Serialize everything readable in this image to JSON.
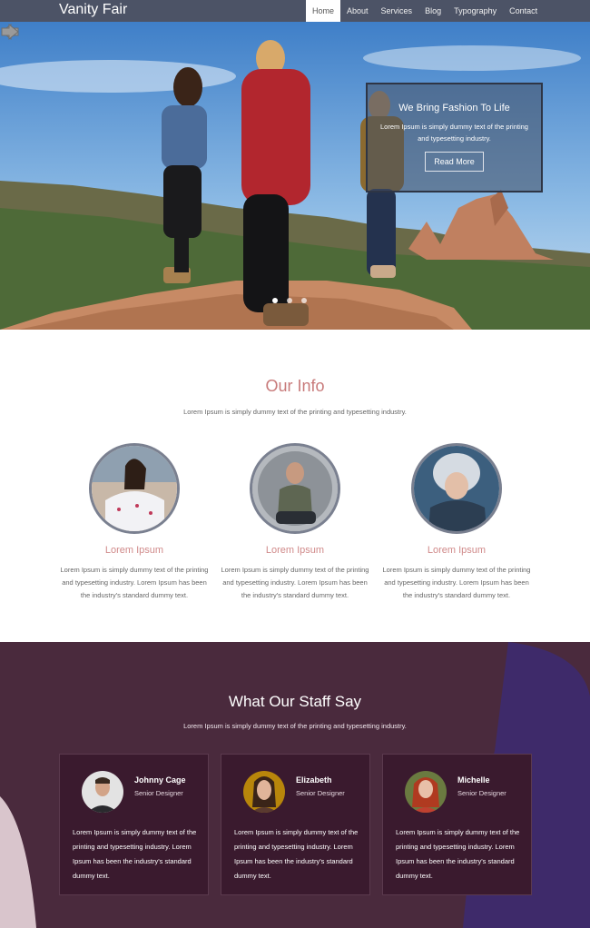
{
  "nav": {
    "brand": "Vanity Fair",
    "items": [
      {
        "label": "Home",
        "active": true
      },
      {
        "label": "About"
      },
      {
        "label": "Services"
      },
      {
        "label": "Blog"
      },
      {
        "label": "Typography"
      },
      {
        "label": "Contact"
      }
    ]
  },
  "hero": {
    "title": "We Bring Fashion To Life",
    "text": "Lorem Ipsum is simply dummy text of the printing and typesetting industry.",
    "button": "Read More"
  },
  "info": {
    "title": "Our Info",
    "subtitle": "Lorem Ipsum is simply dummy text of the printing and typesetting industry.",
    "cards": [
      {
        "name": "Lorem Ipsum",
        "text": "Lorem Ipsum is simply dummy text of the printing and typesetting industry. Lorem Ipsum has been the industry's standard dummy text."
      },
      {
        "name": "Lorem Ipsum",
        "text": "Lorem Ipsum is simply dummy text of the printing and typesetting industry. Lorem Ipsum has been the industry's standard dummy text."
      },
      {
        "name": "Lorem Ipsum",
        "text": "Lorem Ipsum is simply dummy text of the printing and typesetting industry. Lorem Ipsum has been the industry's standard dummy text."
      }
    ]
  },
  "staff": {
    "title": "What Our Staff Say",
    "subtitle": "Lorem Ipsum is simply dummy text of the printing and typesetting industry.",
    "members": [
      {
        "name": "Johnny Cage",
        "role": "Senior Designer",
        "text": "Lorem Ipsum is simply dummy text of the printing and typesetting industry. Lorem Ipsum has been the industry's standard dummy text."
      },
      {
        "name": "Elizabeth",
        "role": "Senior Designer",
        "text": "Lorem Ipsum is simply dummy text of the printing and typesetting industry. Lorem Ipsum has been the industry's standard dummy text."
      },
      {
        "name": "Michelle",
        "role": "Senior Designer",
        "text": "Lorem Ipsum is simply dummy text of the printing and typesetting industry. Lorem Ipsum has been the industry's standard dummy text."
      }
    ]
  },
  "colors": {
    "nav_bg": "#4c5366",
    "accent": "#c87a7a",
    "staff_bg": "#4a2a3d",
    "staff_card": "#3a1a2e"
  }
}
